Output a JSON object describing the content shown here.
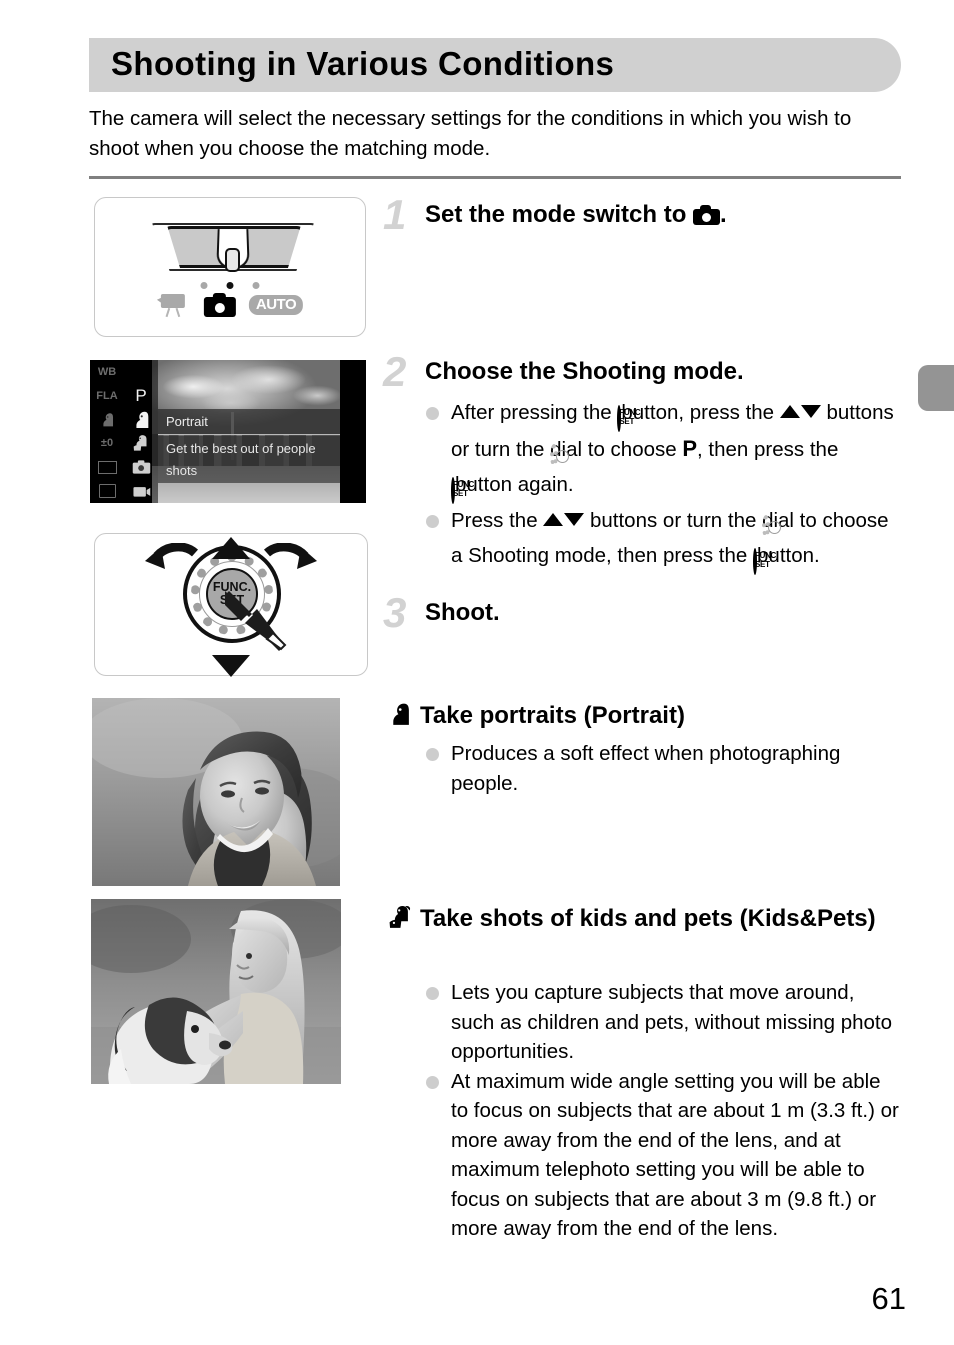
{
  "page": {
    "title": "Shooting in Various Conditions",
    "intro": "The camera will select the necessary settings for the conditions in which you wish to shoot when you choose the matching mode.",
    "number": "61"
  },
  "colors": {
    "banner_bg": "#d0d0d0",
    "step_number": "#d2d2d2",
    "bullet_dot": "#cdcdcd",
    "divider": "#808080",
    "chapter_tab": "#949494"
  },
  "figures": {
    "mode_switch": {
      "icons": [
        "movie-mode-icon",
        "still-camera-mode-icon",
        "auto-mode-icon"
      ],
      "auto_label": "AUTO",
      "selected": "still-camera-mode-icon"
    },
    "lcd": {
      "left_column_icons": [
        "white-balance-icon",
        "flash-auto-icon",
        "portrait-mode-icon",
        "exposure-compensation-icon",
        "aspect-ratio-icon",
        "image-quality-icon"
      ],
      "mid_column_icons": [
        "program-mode-icon",
        "portrait-mode-icon",
        "kids-pets-mode-icon",
        "smart-auto-icon",
        "movie-mode-icon"
      ],
      "program_label": "P",
      "exposure_label": "±0",
      "selected_mode": "Portrait",
      "help_text": "Get the best out of people shots"
    },
    "dial": {
      "center_line1": "FUNC.",
      "center_line2": "SET"
    }
  },
  "steps": [
    {
      "number": "1",
      "heading_before": "Set the mode switch to ",
      "heading_icon": "still-camera-icon",
      "heading_after": "."
    },
    {
      "number": "2",
      "heading": "Choose the Shooting mode.",
      "bullets": [
        {
          "parts": [
            {
              "t": "text",
              "v": "After pressing the "
            },
            {
              "t": "icon",
              "v": "func-set-button-icon"
            },
            {
              "t": "text",
              "v": " button, press the "
            },
            {
              "t": "icon",
              "v": "up-down-buttons-icon"
            },
            {
              "t": "text",
              "v": " buttons or turn the "
            },
            {
              "t": "icon",
              "v": "control-dial-icon"
            },
            {
              "t": "text",
              "v": " dial to choose "
            },
            {
              "t": "icon",
              "v": "program-mode-icon"
            },
            {
              "t": "text",
              "v": ", then press the "
            },
            {
              "t": "icon",
              "v": "func-set-button-icon"
            },
            {
              "t": "text",
              "v": " button again."
            }
          ]
        },
        {
          "parts": [
            {
              "t": "text",
              "v": "Press the "
            },
            {
              "t": "icon",
              "v": "up-down-buttons-icon"
            },
            {
              "t": "text",
              "v": " buttons or turn the "
            },
            {
              "t": "icon",
              "v": "control-dial-icon"
            },
            {
              "t": "text",
              "v": " dial to choose a Shooting mode, then press the "
            },
            {
              "t": "icon",
              "v": "func-set-button-icon"
            },
            {
              "t": "text",
              "v": " button."
            }
          ]
        }
      ]
    },
    {
      "number": "3",
      "heading": "Shoot."
    }
  ],
  "sections": [
    {
      "icon": "portrait-mode-icon",
      "heading": "Take portraits (Portrait)",
      "bullets": [
        "Produces a soft effect when photographing people."
      ]
    },
    {
      "icon": "kids-pets-mode-icon",
      "heading": "Take shots of kids and pets (Kids&Pets)",
      "bullets": [
        "Lets you capture subjects that move around, such as children and pets, without missing photo opportunities.",
        "At maximum wide angle setting you will be able to focus on subjects that are about 1 m (3.3 ft.) or more away from the end of the lens, and at maximum telephoto setting you will be able to focus on subjects that are about 3 m (9.8 ft.) or more away from the end of the lens."
      ]
    }
  ],
  "photos": [
    {
      "name": "portrait-photo",
      "caption_subject": "smiling young woman portrait"
    },
    {
      "name": "kids-pets-photo",
      "caption_subject": "girl hugging a spaniel dog"
    }
  ]
}
